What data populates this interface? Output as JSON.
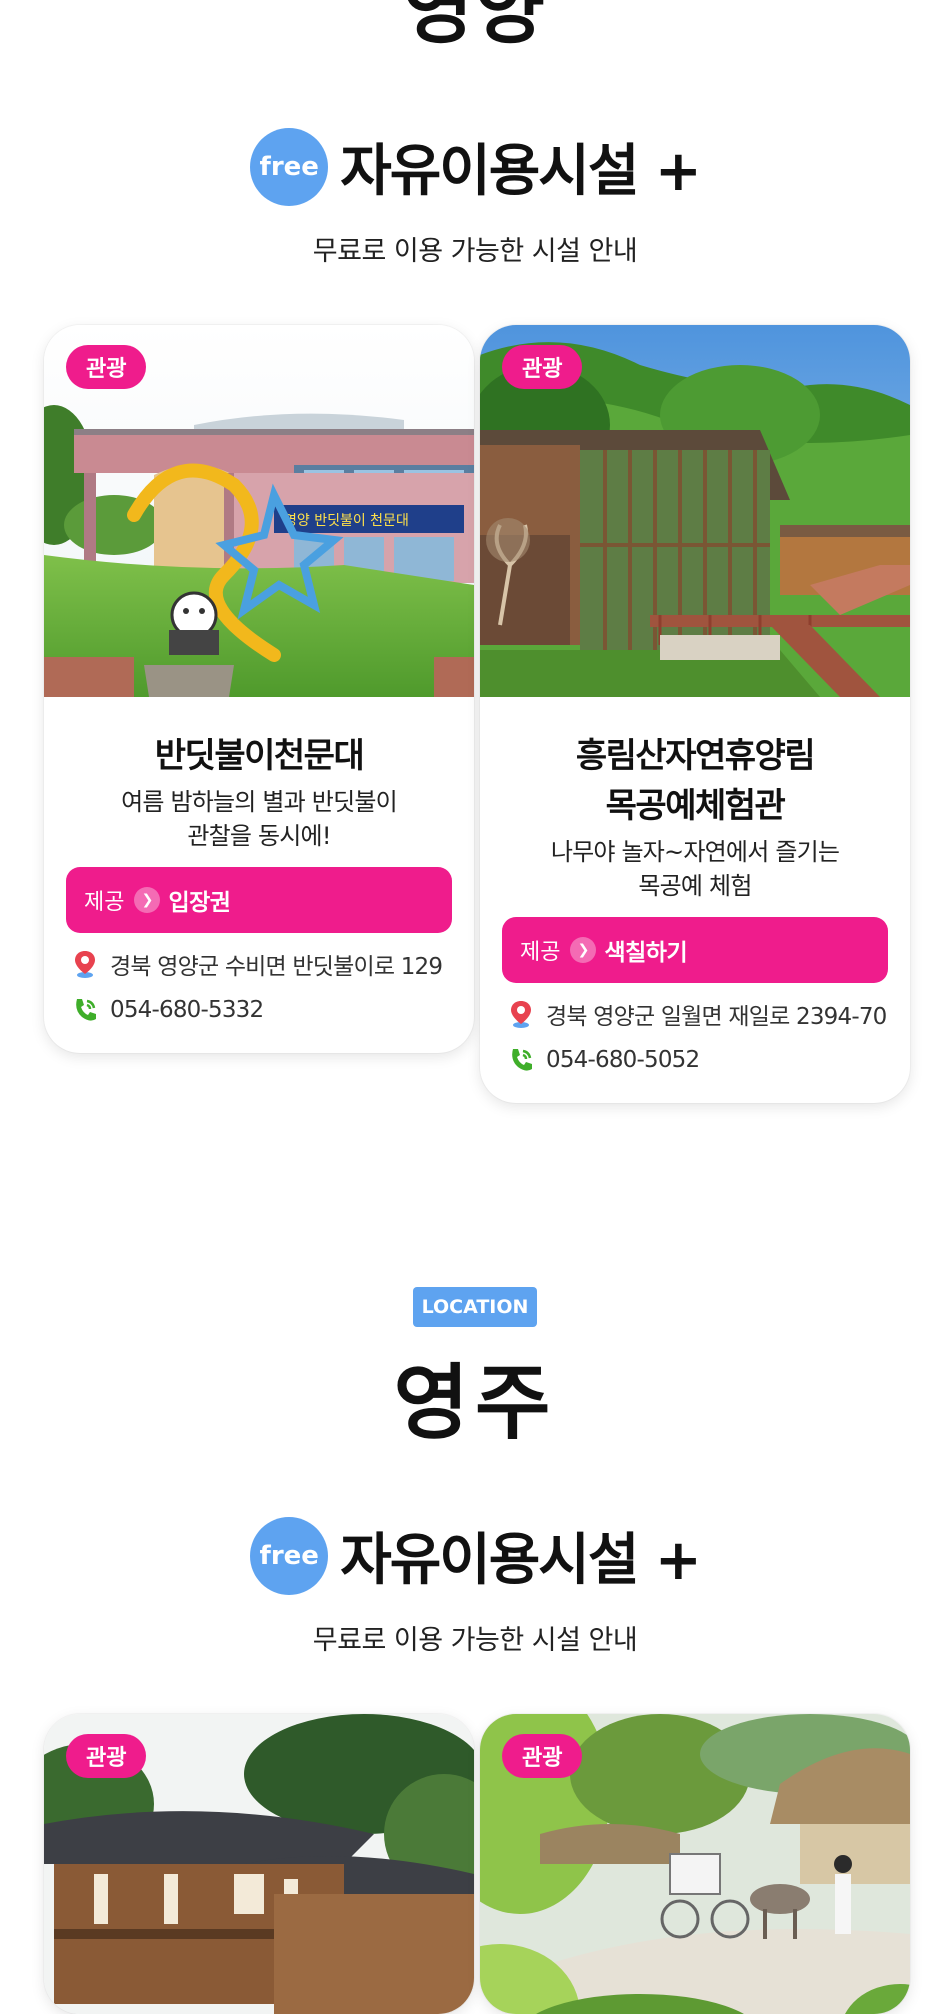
{
  "region_top": {
    "title": "영양"
  },
  "free_section": {
    "badge": "free",
    "title": "자유이용시설 +",
    "subtitle": "무료로 이용 가능한 시설 안내"
  },
  "yeongyang_cards": [
    {
      "tag": "관광",
      "title": "반딧불이천문대",
      "desc": "여름 밤하늘의 별과 반딧불이\n관찰을 동시에!",
      "offer_label": "제공",
      "offer_value": "입장권",
      "address": "경북 영양군 수비면 반딧불이로 129",
      "phone": "054-680-5332",
      "sign_text": "영양 반딧불이 천문대"
    },
    {
      "tag": "관광",
      "title": "흥림산자연휴양림\n목공예체험관",
      "desc": "나무야 놀자~자연에서 즐기는\n목공예 체험",
      "offer_label": "제공",
      "offer_value": "색칠하기",
      "address": "경북 영양군 일월면 재일로 2394-70",
      "phone": "054-680-5052"
    }
  ],
  "location_section": {
    "badge": "LOCATION",
    "region": "영주"
  },
  "yeongju_free_section": {
    "badge": "free",
    "title": "자유이용시설 +",
    "subtitle": "무료로 이용 가능한 시설 안내"
  },
  "yeongju_cards": [
    {
      "tag": "관광"
    },
    {
      "tag": "관광"
    }
  ],
  "colors": {
    "accent_pink": "#ef1c8c",
    "accent_blue": "#5ea3f0",
    "phone_green": "#3fae2a",
    "pin_red": "#e8424f"
  },
  "icons": [
    "location-pin-icon",
    "phone-icon",
    "arrow-right-icon"
  ]
}
